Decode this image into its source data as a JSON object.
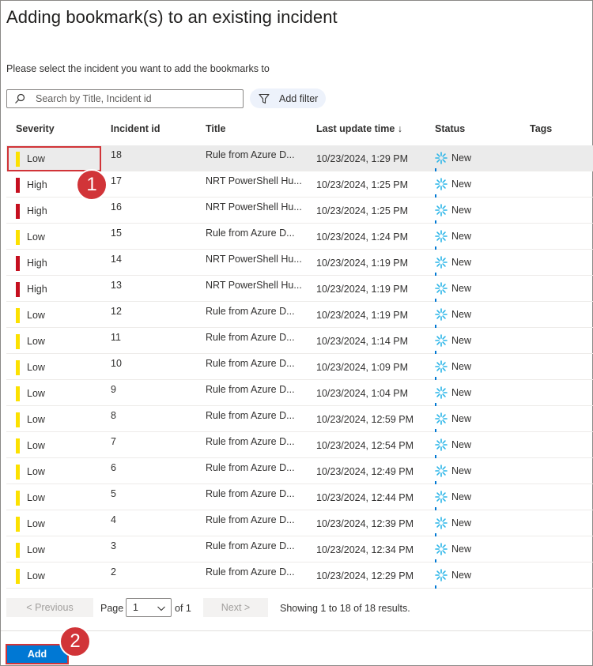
{
  "dialog": {
    "title": "Adding bookmark(s) to an existing incident",
    "subtitle": "Please select the incident you want to add the bookmarks to"
  },
  "search": {
    "placeholder": "Search by Title, Incident id",
    "icon": "search-icon"
  },
  "filter": {
    "label": "Add filter",
    "icon": "filter-icon"
  },
  "columns": {
    "severity": "Severity",
    "incident_id": "Incident id",
    "title": "Title",
    "last_update": "Last update time ↓",
    "status": "Status",
    "tags": "Tags"
  },
  "colors": {
    "high": "#c50f1f",
    "low": "#fce100",
    "accent": "#0078d4",
    "callout": "#d13438"
  },
  "rows": [
    {
      "severity": "Low",
      "id": "18",
      "title": "Rule from Azure D...",
      "updated": "10/23/2024, 1:29 PM",
      "status": "New"
    },
    {
      "severity": "High",
      "id": "17",
      "title": "NRT PowerShell Hu...",
      "updated": "10/23/2024, 1:25 PM",
      "status": "New"
    },
    {
      "severity": "High",
      "id": "16",
      "title": "NRT PowerShell Hu...",
      "updated": "10/23/2024, 1:25 PM",
      "status": "New"
    },
    {
      "severity": "Low",
      "id": "15",
      "title": "Rule from Azure D...",
      "updated": "10/23/2024, 1:24 PM",
      "status": "New"
    },
    {
      "severity": "High",
      "id": "14",
      "title": "NRT PowerShell Hu...",
      "updated": "10/23/2024, 1:19 PM",
      "status": "New"
    },
    {
      "severity": "High",
      "id": "13",
      "title": "NRT PowerShell Hu...",
      "updated": "10/23/2024, 1:19 PM",
      "status": "New"
    },
    {
      "severity": "Low",
      "id": "12",
      "title": "Rule from Azure D...",
      "updated": "10/23/2024, 1:19 PM",
      "status": "New"
    },
    {
      "severity": "Low",
      "id": "11",
      "title": "Rule from Azure D...",
      "updated": "10/23/2024, 1:14 PM",
      "status": "New"
    },
    {
      "severity": "Low",
      "id": "10",
      "title": "Rule from Azure D...",
      "updated": "10/23/2024, 1:09 PM",
      "status": "New"
    },
    {
      "severity": "Low",
      "id": "9",
      "title": "Rule from Azure D...",
      "updated": "10/23/2024, 1:04 PM",
      "status": "New"
    },
    {
      "severity": "Low",
      "id": "8",
      "title": "Rule from Azure D...",
      "updated": "10/23/2024, 12:59 PM",
      "status": "New"
    },
    {
      "severity": "Low",
      "id": "7",
      "title": "Rule from Azure D...",
      "updated": "10/23/2024, 12:54 PM",
      "status": "New"
    },
    {
      "severity": "Low",
      "id": "6",
      "title": "Rule from Azure D...",
      "updated": "10/23/2024, 12:49 PM",
      "status": "New"
    },
    {
      "severity": "Low",
      "id": "5",
      "title": "Rule from Azure D...",
      "updated": "10/23/2024, 12:44 PM",
      "status": "New"
    },
    {
      "severity": "Low",
      "id": "4",
      "title": "Rule from Azure D...",
      "updated": "10/23/2024, 12:39 PM",
      "status": "New"
    },
    {
      "severity": "Low",
      "id": "3",
      "title": "Rule from Azure D...",
      "updated": "10/23/2024, 12:34 PM",
      "status": "New"
    },
    {
      "severity": "Low",
      "id": "2",
      "title": "Rule from Azure D...",
      "updated": "10/23/2024, 12:29 PM",
      "status": "New"
    }
  ],
  "selected_row": 0,
  "pager": {
    "prev_label": "< Previous",
    "next_label": "Next >",
    "page_label": "Page",
    "page_value": "1",
    "of_label": "of 1",
    "results": "Showing 1 to 18 of 18 results."
  },
  "footer": {
    "add_label": "Add"
  },
  "callouts": {
    "one": "1",
    "two": "2"
  }
}
